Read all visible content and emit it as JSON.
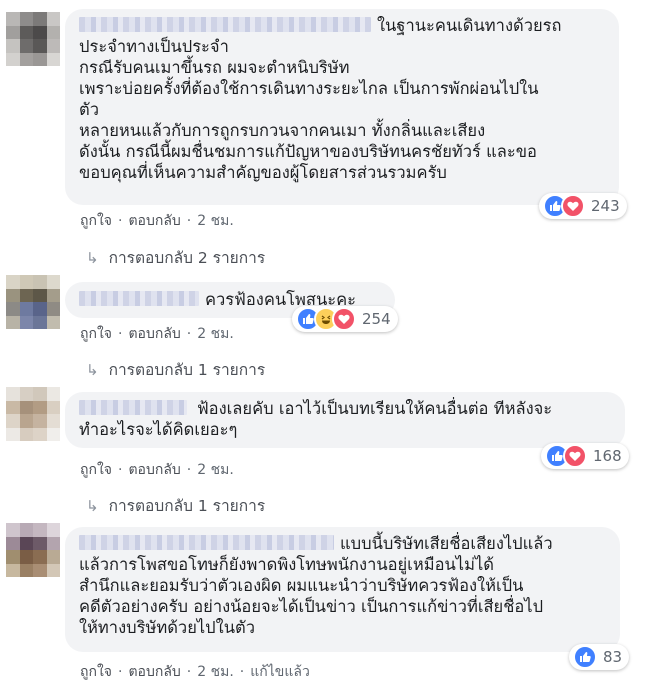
{
  "comments": [
    {
      "lines": [
        "ในฐานะคนเดินทางด้วยรถ",
        "ประจำทางเป็นประจำ",
        "กรณีรับคนเมาขึ้นรถ ผมจะตำหนิบริษัท",
        "เพราะบ่อยครั้งที่ต้องใช้การเดินทางระยะไกล เป็นการพักผ่อนไปใน",
        "ตัว",
        "หลายหนแล้วกับการถูกรบกวนจากคนเมา ทั้งกลิ่นและเสียง",
        "ดังนั้น กรณีนี้ผมชื่นชมการแก้ปัญหาของบริษัทนครชัยทัวร์ และขอ",
        "ขอบคุณที่เห็นความสำคัญของผู้โดยสารส่วนรวมครับ"
      ],
      "like_label": "ถูกใจ",
      "reply_label": "ตอบกลับ",
      "time": "2 ชม.",
      "reaction_count": "243",
      "replies_label": "การตอบกลับ 2 รายการ"
    },
    {
      "lines": [
        "ควรฟ้องคนโพสนะคะ"
      ],
      "like_label": "ถูกใจ",
      "reply_label": "ตอบกลับ",
      "time": "2 ชม.",
      "reaction_count": "254",
      "replies_label": "การตอบกลับ 1 รายการ"
    },
    {
      "lines": [
        "ฟ้องเลยคับ เอาไว้เป็นบทเรียนให้คนอื่นต่อ ทีหลังจะ",
        "ทำอะไรจะได้คิดเยอะๆ"
      ],
      "like_label": "ถูกใจ",
      "reply_label": "ตอบกลับ",
      "time": "2 ชม.",
      "reaction_count": "168",
      "replies_label": "การตอบกลับ 1 รายการ"
    },
    {
      "lines": [
        "แบบนี้บริษัทเสียชื่อเสียงไปแล้ว",
        "แล้วการโพสขอโทษก็ยังพาดพิงโทษพนักงานอยู่เหมือนไม่ได้",
        "สำนึกและยอมรับว่าตัวเองผิด ผมแนะนำว่าบริษัทควรฟ้องให้เป็น",
        "คดีตัวอย่างครับ อย่างน้อยจะได้เป็นข่าว เป็นการแก้ข่าวที่เสียชื่อไป",
        "ให้ทางบริษัทด้วยไปในตัว"
      ],
      "like_label": "ถูกใจ",
      "reply_label": "ตอบกลับ",
      "time": "2 ชม.",
      "edited_label": "แก้ไขแล้ว",
      "reaction_count": "83"
    }
  ],
  "colors": {
    "bubble": "#f2f3f5",
    "meta_text": "#606770",
    "like_blue": "#4080ff",
    "love_red": "#f25268",
    "haha_yellow": "#fcd05b"
  }
}
